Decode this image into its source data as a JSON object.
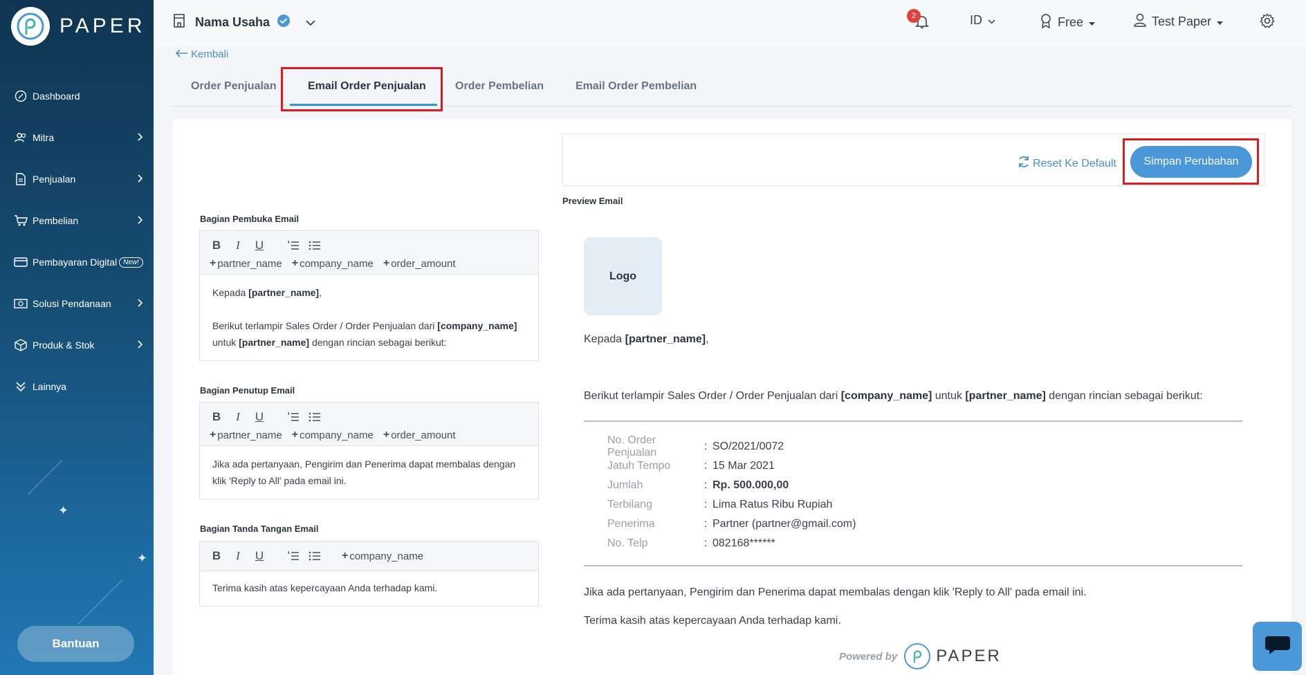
{
  "brand": {
    "name": "PAPER"
  },
  "sidebar": {
    "items": [
      {
        "label": "Dashboard",
        "icon": "dashboard-icon"
      },
      {
        "label": "Mitra",
        "icon": "users-icon"
      },
      {
        "label": "Penjualan",
        "icon": "document-icon"
      },
      {
        "label": "Pembelian",
        "icon": "cart-icon"
      },
      {
        "label": "Pembayaran Digital",
        "icon": "card-icon",
        "badge": "New!"
      },
      {
        "label": "Solusi Pendanaan",
        "icon": "money-icon"
      },
      {
        "label": "Produk & Stok",
        "icon": "box-icon"
      },
      {
        "label": "Lainnya",
        "icon": "chevrons-down-icon"
      }
    ],
    "help_label": "Bantuan"
  },
  "header": {
    "business_name": "Nama Usaha",
    "notification_count": "2",
    "language": "ID",
    "plan": "Free",
    "user": "Test Paper"
  },
  "back_label": "Kembali",
  "tabs": [
    "Order Penjualan",
    "Email Order Penjualan",
    "Order Pembelian",
    "Email Order Pembelian"
  ],
  "editor": {
    "opening_label": "Bagian Pembuka Email",
    "closing_label": "Bagian Penutup Email",
    "signature_label": "Bagian Tanda Tangan Email",
    "vars": [
      "partner_name",
      "company_name",
      "order_amount"
    ],
    "signature_var": "company_name",
    "opening": {
      "greet_pre": "Kepada ",
      "greet_var": "[partner_name]",
      "greet_post": ",",
      "p1": "Berikut terlampir Sales Order / Order Penjualan dari ",
      "p1_var1": "[company_name]",
      "p1_mid": "untuk ",
      "p1_var2": "[partner_name]",
      "p1_end": " dengan rincian sebagai berikut:"
    },
    "closing_text": "Jika ada pertanyaan, Pengirim dan Penerima dapat membalas dengan klik 'Reply to All' pada email ini.",
    "signature_text": "Terima kasih atas kepercayaan Anda terhadap kami."
  },
  "preview": {
    "reset_label": "Reset Ke Default",
    "save_label": "Simpan Perubahan",
    "title": "Preview Email",
    "logo_label": "Logo",
    "greet_pre": "Kepada ",
    "greet_var": "[partner_name]",
    "greet_post": ",",
    "p1": "Berikut terlampir Sales Order / Order Penjualan dari ",
    "p1_var1": "[company_name]",
    "p1_mid": " untuk ",
    "p1_var2": "[partner_name]",
    "p1_end": " dengan rincian sebagai berikut:",
    "order_rows": [
      {
        "key": "No. Order Penjualan",
        "value": "SO/2021/0072"
      },
      {
        "key": "Jatuh Tempo",
        "value": "15 Mar 2021"
      },
      {
        "key": "Jumlah",
        "value": "Rp. 500.000,00"
      },
      {
        "key": "Terbilang",
        "value": "Lima Ratus Ribu Rupiah"
      },
      {
        "key": "Penerima",
        "value": "Partner (partner@gmail.com)"
      },
      {
        "key": "No. Telp",
        "value": "082168******"
      }
    ],
    "closing_text": "Jika ada pertanyaan, Pengirim dan Penerima dapat membalas dengan klik 'Reply to All' pada email ini.",
    "signature_text": "Terima kasih atas kepercayaan Anda terhadap kami.",
    "powered_by": "Powered by",
    "powered_brand": "PAPER"
  },
  "colors": {
    "accent": "#4a98d8",
    "highlight": "#e0191f",
    "notification": "#e0433f"
  }
}
